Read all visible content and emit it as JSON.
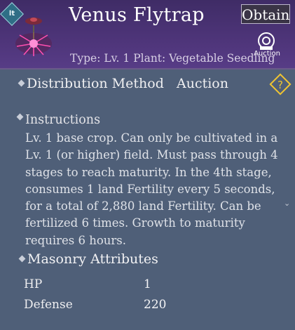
{
  "header": {
    "grade_badge": "lt",
    "title": "Venus Flytrap",
    "obtain_label": "Obtain",
    "auction_label": "Auction",
    "type_line": "Type: Lv. 1 Plant: Vegetable Seedling",
    "accent": "#4d3478"
  },
  "distribution": {
    "label": "Distribution Method",
    "value": "Auction"
  },
  "instructions": {
    "title": "Instructions",
    "text": "Lv. 1 base crop. Can only be cultivated in a Lv. 1 (or higher) field. Must pass through 4 stages to reach maturity. In the 4th stage, consumes 1 land Fertility every 5 seconds, for a total of 2,880 land Fertility. Can be fertilized 6 times. Growth to maturity requires 6 hours."
  },
  "attributes": {
    "title": "Masonry Attributes",
    "rows": [
      {
        "label": "HP",
        "value": "1"
      },
      {
        "label": "Defense",
        "value": "220"
      }
    ]
  },
  "icons": [
    "grade-badge-icon",
    "venus-flytrap-item-icon",
    "auction-icon",
    "help-icon",
    "scroll-down-icon"
  ]
}
